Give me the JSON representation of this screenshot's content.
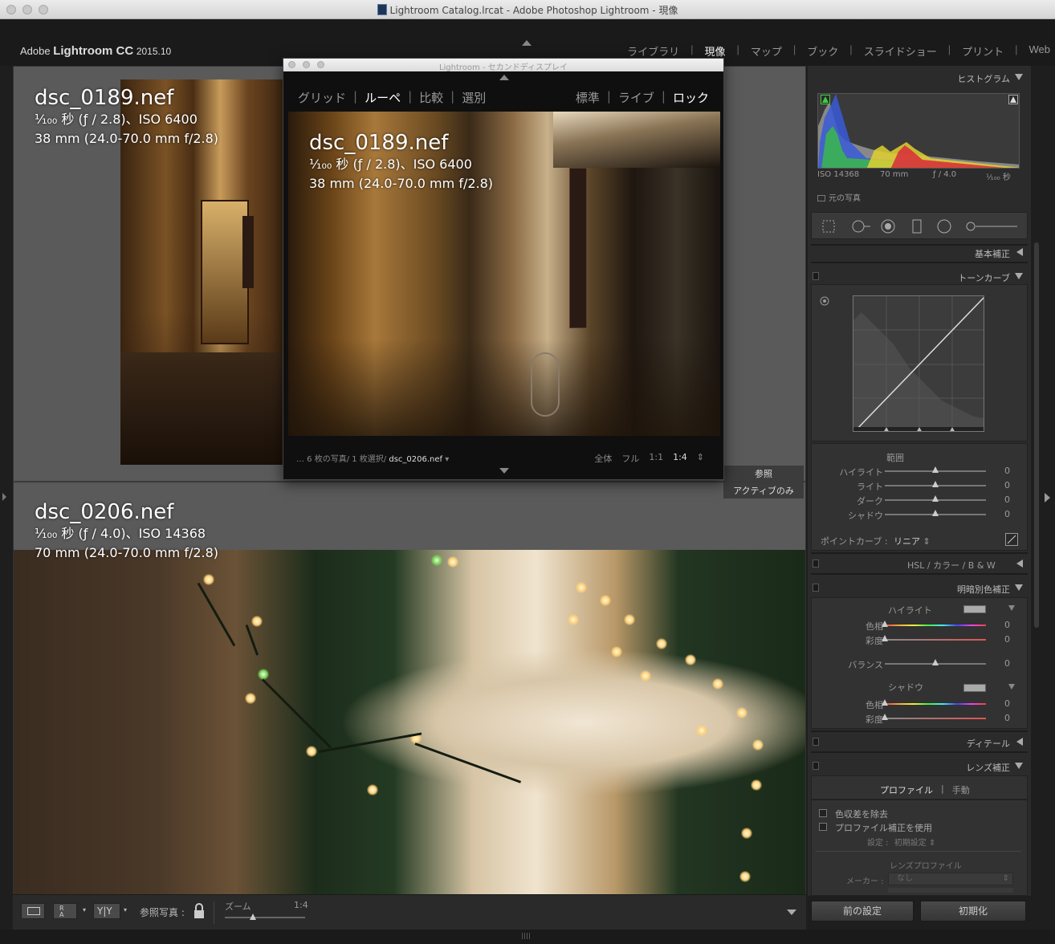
{
  "window": {
    "title": "Lightroom Catalog.lrcat - Adobe Photoshop Lightroom - 現像"
  },
  "brand": {
    "prefix": "Adobe",
    "name": "Lightroom CC",
    "version": "2015.10"
  },
  "modules": [
    {
      "label": "ライブラリ",
      "active": false
    },
    {
      "label": "現像",
      "active": true
    },
    {
      "label": "マップ",
      "active": false
    },
    {
      "label": "ブック",
      "active": false
    },
    {
      "label": "スライドショー",
      "active": false
    },
    {
      "label": "プリント",
      "active": false
    },
    {
      "label": "Web",
      "active": false
    }
  ],
  "top_pane": {
    "filename": "dsc_0189.nef",
    "exposure_line": "¹⁄₁₀₀ 秒 (ƒ / 2.8)、ISO 6400",
    "lens_line": "38 mm (24.0-70.0 mm f/2.8)",
    "label": "参照"
  },
  "bottom_pane": {
    "filename": "dsc_0206.nef",
    "exposure_line": "¹⁄₁₀₀ 秒 (ƒ / 4.0)、ISO 14368",
    "lens_line": "70 mm (24.0-70.0 mm f/2.8)",
    "label": "アクティブのみ"
  },
  "secondary_window": {
    "title": "Lightroom - セカンドディスプレイ",
    "nav_left": [
      "グリッド",
      "ルーペ",
      "比較",
      "選別"
    ],
    "nav_left_active": "ルーペ",
    "nav_right": [
      "標準",
      "ライブ",
      "ロック"
    ],
    "nav_right_active": "ロック",
    "filename": "dsc_0189.nef",
    "exposure_line": "¹⁄₁₀₀ 秒 (ƒ / 2.8)、ISO 6400",
    "lens_line": "38 mm (24.0-70.0 mm f/2.8)",
    "filmstrip_prefix": "… 6 枚の写真/ 1 枚選択/",
    "filmstrip_current": "dsc_0206.nef",
    "zoom_options": [
      "全体",
      "フル",
      "1:1",
      "1:4"
    ],
    "zoom_active": "1:4"
  },
  "right_panel": {
    "histogram": {
      "title": "ヒストグラム",
      "iso": "ISO 14368",
      "focal": "70 mm",
      "aperture": "ƒ / 4.0",
      "shutter": "¹⁄₁₀₀ 秒",
      "original_photo_label": "元の写真"
    },
    "basic": {
      "title": "基本補正"
    },
    "tone_curve": {
      "title": "トーンカーブ",
      "range_label": "範囲",
      "sliders": [
        {
          "name": "ハイライト",
          "value": "0",
          "pos": 0.5
        },
        {
          "name": "ライト",
          "value": "0",
          "pos": 0.5
        },
        {
          "name": "ダーク",
          "value": "0",
          "pos": 0.5
        },
        {
          "name": "シャドウ",
          "value": "0",
          "pos": 0.5
        }
      ],
      "point_curve_label": "ポイントカーブ :",
      "point_curve_value": "リニア"
    },
    "hsl": {
      "tabs": [
        "HSL",
        "カラー",
        "B & W"
      ]
    },
    "split_toning": {
      "title": "明暗別色補正",
      "highlight_label": "ハイライト",
      "highlight_sliders": [
        {
          "name": "色相",
          "value": "0",
          "kind": "hue"
        },
        {
          "name": "彩度",
          "value": "0",
          "kind": "sat"
        }
      ],
      "balance": {
        "name": "バランス",
        "value": "0"
      },
      "shadow_label": "シャドウ",
      "shadow_sliders": [
        {
          "name": "色相",
          "value": "0",
          "kind": "hue"
        },
        {
          "name": "彩度",
          "value": "0",
          "kind": "sat"
        }
      ]
    },
    "detail": {
      "title": "ディテール"
    },
    "lens": {
      "title": "レンズ補正",
      "tabs": [
        "プロファイル",
        "手動"
      ],
      "active_tab": "プロファイル",
      "checkbox_ca": "色収差を除去",
      "checkbox_profile": "プロファイル補正を使用",
      "setup_label": "設定 :",
      "setup_value": "初期設定",
      "lens_profile_label": "レンズプロファイル",
      "maker_label": "メーカー :",
      "maker_value": "なし"
    },
    "buttons": {
      "previous": "前の設定",
      "reset": "初期化"
    }
  },
  "bottom_toolbar": {
    "reference_label": "参照写真 :",
    "zoom_label": "ズーム",
    "zoom_value": "1:4",
    "zoom_level": 0.35
  }
}
